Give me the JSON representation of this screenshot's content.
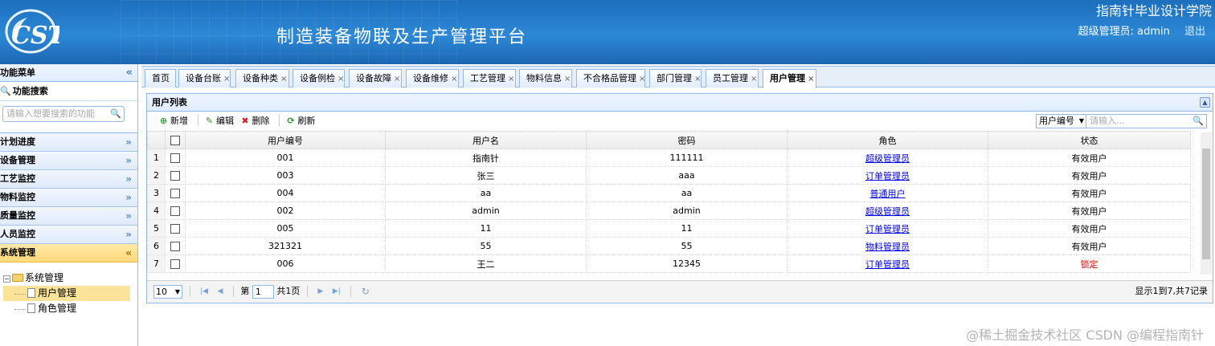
{
  "header": {
    "logo_text": "CST",
    "app_title": "制造装备物联及生产管理平台",
    "school": "指南针毕业设计学院",
    "user_label": "超级管理员: admin",
    "logout": "退出"
  },
  "sidebar": {
    "title": "功能菜单",
    "search_title": "功能搜索",
    "search_placeholder": "请输入想要搜索的功能",
    "menus": [
      {
        "label": "计划进度"
      },
      {
        "label": "设备管理"
      },
      {
        "label": "工艺监控"
      },
      {
        "label": "物料监控"
      },
      {
        "label": "质量监控"
      },
      {
        "label": "人员监控"
      },
      {
        "label": "系统管理"
      }
    ],
    "tree": {
      "root": "系统管理",
      "children": [
        "用户管理",
        "角色管理"
      ]
    }
  },
  "tabs": [
    "首页",
    "设备台账",
    "设备种类",
    "设备例检",
    "设备故障",
    "设备维修",
    "工艺管理",
    "物料信息",
    "不合格品管理",
    "部门管理",
    "员工管理",
    "用户管理"
  ],
  "panel": {
    "title": "用户列表",
    "toolbar": {
      "add": "新增",
      "edit": "编辑",
      "delete": "删除",
      "refresh": "刷新"
    },
    "search_field": "用户编号",
    "search_placeholder": "请输入..."
  },
  "table": {
    "columns": [
      "用户编号",
      "用户名",
      "密码",
      "角色",
      "状态"
    ],
    "rows": [
      {
        "n": "1",
        "id": "001",
        "name": "指南针",
        "pwd": "111111",
        "role": "超级管理员",
        "status": "有效用户"
      },
      {
        "n": "2",
        "id": "003",
        "name": "张三",
        "pwd": "aaa",
        "role": "订单管理员",
        "status": "有效用户"
      },
      {
        "n": "3",
        "id": "004",
        "name": "aa",
        "pwd": "aa",
        "role": "普通用户",
        "status": "有效用户"
      },
      {
        "n": "4",
        "id": "002",
        "name": "admin",
        "pwd": "admin",
        "role": "超级管理员",
        "status": "有效用户"
      },
      {
        "n": "5",
        "id": "005",
        "name": "11",
        "pwd": "11",
        "role": "订单管理员",
        "status": "有效用户"
      },
      {
        "n": "6",
        "id": "321321",
        "name": "55",
        "pwd": "55",
        "role": "物料管理员",
        "status": "有效用户"
      },
      {
        "n": "7",
        "id": "006",
        "name": "王二",
        "pwd": "12345",
        "role": "订单管理员",
        "status": "锁定"
      }
    ]
  },
  "pager": {
    "page_size": "10",
    "page_prefix": "第",
    "page": "1",
    "page_total": "共1页",
    "summary": "显示1到7,共7记录"
  },
  "watermark": "@稀土掘金技术社区 CSDN @编程指南针",
  "colors": {
    "header_blue": "#2d88d6",
    "border_blue": "#95b8e7",
    "active_menu": "#ffd97a",
    "locked_red": "#e00000"
  }
}
